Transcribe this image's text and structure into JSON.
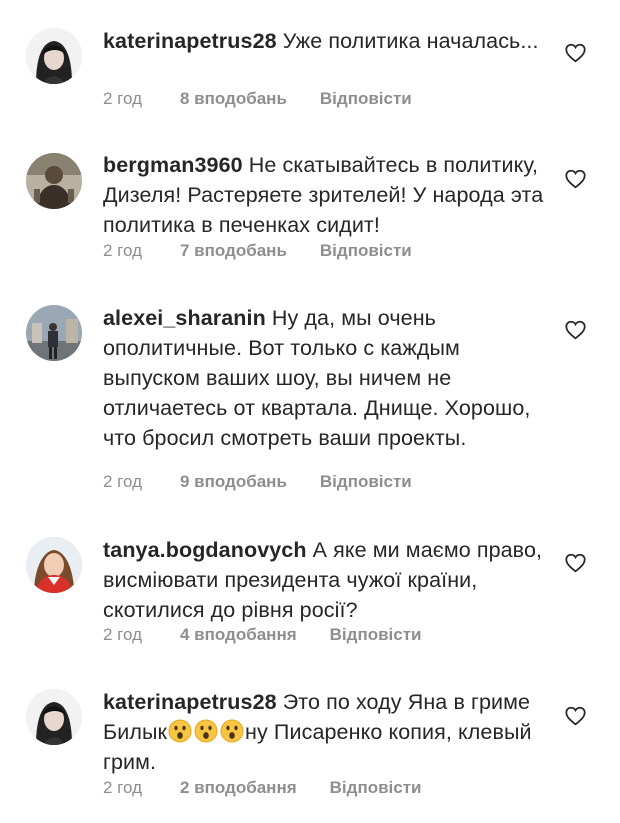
{
  "comments": [
    {
      "username": "katerinapetrus28",
      "text": "Уже политика началась...",
      "time": "2 год",
      "likes": "8 вподобань",
      "reply": "Відповісти"
    },
    {
      "username": "bergman3960",
      "text": "Не скатывайтесь в политику, Дизеля! Растеряете зрителей! У народа эта политика в печенках сидит!",
      "time": "2 год",
      "likes": "7 вподобань",
      "reply": "Відповісти"
    },
    {
      "username": "alexei_sharanin",
      "text": "Ну да, мы очень ополитичные. Вот только с каждым выпуском ваших шоу, вы ничем не отличаетесь от квартала. Днище. Хорошо, что бросил смотреть ваши проекты.",
      "time": "2 год",
      "likes": "9 вподобань",
      "reply": "Відповісти"
    },
    {
      "username": "tanya.bogdanovych",
      "text": "А яке ми маємо право, висміювати президента чужої країни, скотилися до рівня росії?",
      "time": "2 год",
      "likes": "4 вподобання",
      "reply": "Відповісти"
    },
    {
      "username": "katerinapetrus28",
      "text_before": "Это по ходу Яна в гриме Билык",
      "emojis": [
        "astonished-face",
        "astonished-face",
        "astonished-face"
      ],
      "text_after": "ну Писаренко копия, клевый грим.",
      "time": "2 год",
      "likes": "2 вподобання",
      "reply": "Відповісти"
    }
  ]
}
